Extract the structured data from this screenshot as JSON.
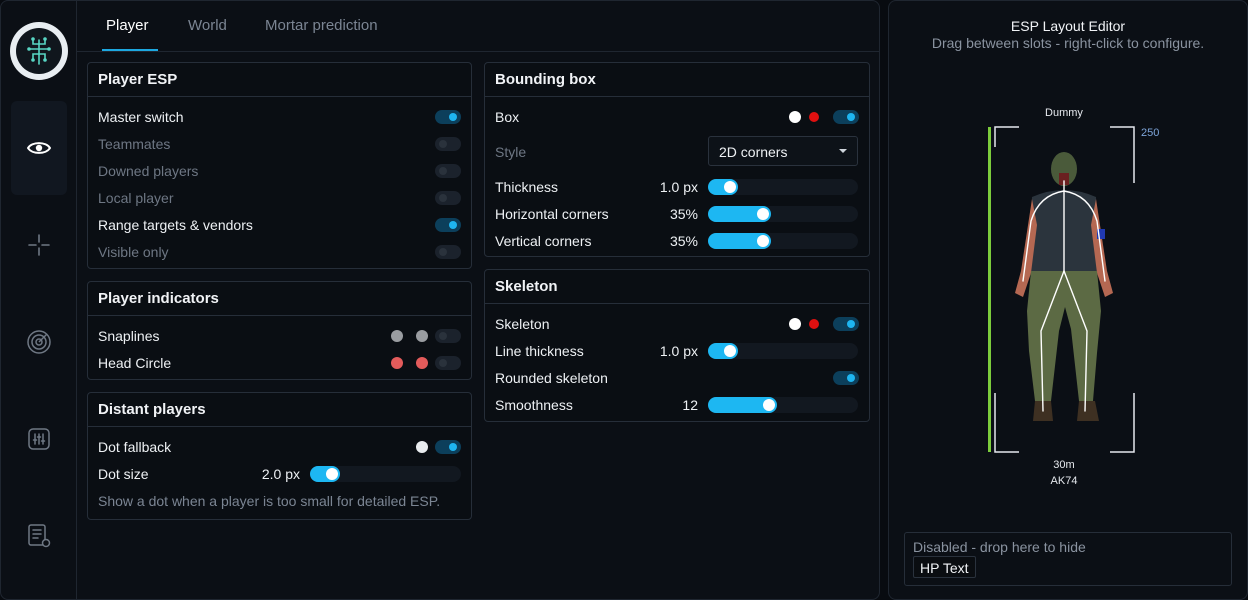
{
  "tabs": [
    "Player",
    "World",
    "Mortar prediction"
  ],
  "sidebar": {
    "items": [
      {
        "icon": "eye-icon",
        "active": true
      },
      {
        "icon": "crosshair-icon",
        "active": false
      },
      {
        "icon": "radar-icon",
        "active": false
      },
      {
        "icon": "sliders-icon",
        "active": false
      },
      {
        "icon": "config-list-icon",
        "active": false
      }
    ]
  },
  "player_esp": {
    "title": "Player ESP",
    "rows": [
      {
        "label": "Master switch",
        "on": true,
        "dim": false
      },
      {
        "label": "Teammates",
        "on": false,
        "dim": true
      },
      {
        "label": "Downed players",
        "on": false,
        "dim": true
      },
      {
        "label": "Local player",
        "on": false,
        "dim": true
      },
      {
        "label": "Range targets & vendors",
        "on": true,
        "dim": false
      },
      {
        "label": "Visible only",
        "on": false,
        "dim": true
      }
    ]
  },
  "player_indicators": {
    "title": "Player indicators",
    "rows": [
      {
        "label": "Snaplines",
        "dot_color": "#9a9da1"
      },
      {
        "label": "Head Circle",
        "dot_color": "#e35b5b"
      }
    ]
  },
  "distant_players": {
    "title": "Distant players",
    "dot_fallback_label": "Dot fallback",
    "dot_size_label": "Dot size",
    "dot_size_value": "2.0 px",
    "dot_size_level": 0.2,
    "note": "Show a dot when a player is too small for detailed ESP."
  },
  "bounding_box": {
    "title": "Bounding box",
    "box_label": "Box",
    "style_label": "Style",
    "style_value": "2D corners",
    "sliders": [
      {
        "label": "Thickness",
        "value": "1.0 px",
        "level": 0.2
      },
      {
        "label": "Horizontal corners",
        "value": "35%",
        "level": 0.42
      },
      {
        "label": "Vertical corners",
        "value": "35%",
        "level": 0.42
      }
    ]
  },
  "skeleton": {
    "title": "Skeleton",
    "skeleton_label": "Skeleton",
    "line_thickness_label": "Line thickness",
    "line_thickness_value": "1.0 px",
    "line_thickness_level": 0.2,
    "rounded_label": "Rounded skeleton",
    "smoothness_label": "Smoothness",
    "smoothness_value": "12",
    "smoothness_level": 0.46
  },
  "editor": {
    "title": "ESP Layout Editor",
    "subtitle": "Drag between slots - right-click to configure.",
    "name_label": "Dummy",
    "health_value": "250",
    "distance_label": "30m",
    "weapon_label": "AK74",
    "disabled_title": "Disabled - drop here to hide",
    "disabled_chip": "HP Text"
  },
  "colors": {
    "accent": "#1db7f2",
    "red": "#e01010",
    "healthbar": "#7ccc3c"
  }
}
